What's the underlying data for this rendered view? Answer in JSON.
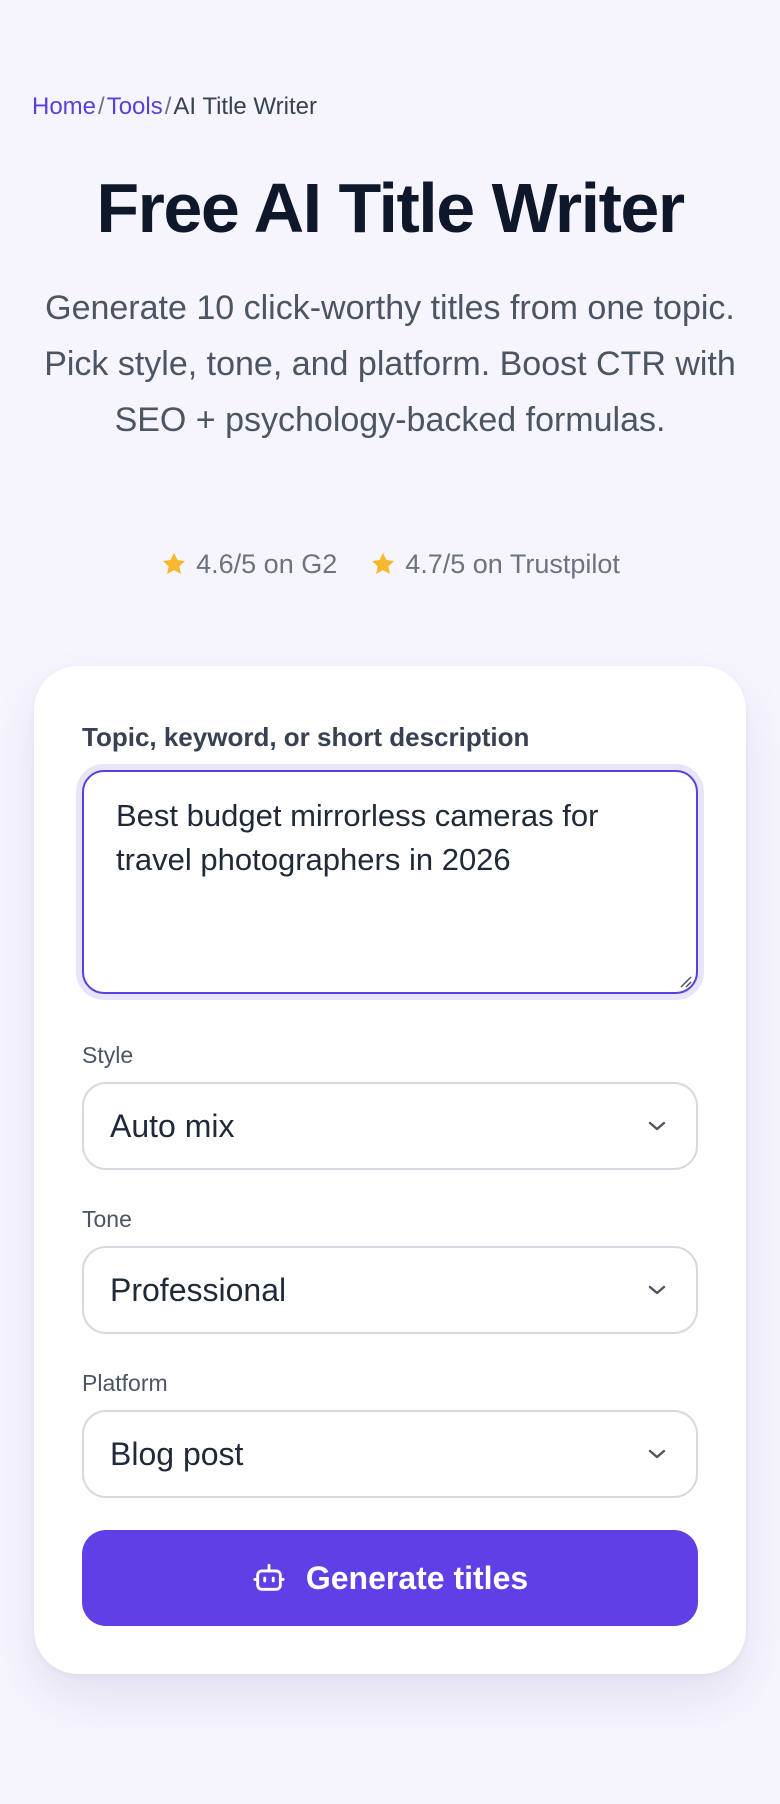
{
  "breadcrumb": {
    "items": [
      {
        "label": "Home"
      },
      {
        "label": "Tools"
      },
      {
        "label": "AI Title Writer"
      }
    ],
    "separator": "/"
  },
  "hero": {
    "title": "Free AI Title Writer",
    "subtitle": "Generate 10 click-worthy titles from one topic. Pick style, tone, and platform. Boost CTR with SEO + psychology-backed formulas."
  },
  "ratings": [
    {
      "icon": "star-icon",
      "text": "4.6/5 on G2"
    },
    {
      "icon": "star-icon",
      "text": "4.7/5 on Trustpilot"
    }
  ],
  "form": {
    "topic_label": "Topic, keyword, or short description",
    "topic_value": "Best budget mirrorless cameras for travel photographers in 2026",
    "style_label": "Style",
    "style_value": "Auto mix",
    "tone_label": "Tone",
    "tone_value": "Professional",
    "platform_label": "Platform",
    "platform_value": "Blog post",
    "submit_label": "Generate titles",
    "submit_icon": "robot-icon"
  },
  "colors": {
    "accent": "#6040e6",
    "link": "#5b3fd9",
    "star": "#f5b82e",
    "background": "#f6f5fe"
  }
}
